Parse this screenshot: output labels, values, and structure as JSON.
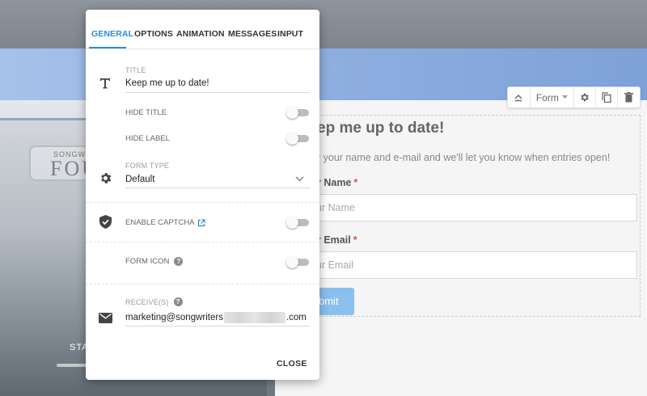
{
  "background": {
    "logo_small": "SONGWRI",
    "logo_big": "FOU",
    "footer_text": "STA"
  },
  "form_preview": {
    "title": "ep me up to date!",
    "description": "r your name and e-mail and we'll let you know when entries open!",
    "name_label": "r Name",
    "name_placeholder": "ur Name",
    "email_label": "r Email",
    "email_placeholder": "ur Email",
    "required_mark": "*",
    "submit_label": "bmit"
  },
  "element_toolbar": {
    "form_label": "Form"
  },
  "modal": {
    "tabs": [
      {
        "label": "GENERAL",
        "active": true
      },
      {
        "label": "OPTIONS",
        "active": false
      },
      {
        "label": "ANIMATION",
        "active": false
      },
      {
        "label": "MESSAGES",
        "active": false
      },
      {
        "label": "INPUT",
        "active": false
      }
    ],
    "title_label": "TITLE",
    "title_value": "Keep me up to date!",
    "hide_title_label": "HIDE TITLE",
    "hide_title_on": false,
    "hide_label_label": "HIDE LABEL",
    "hide_label_on": false,
    "form_type_label": "FORM TYPE",
    "form_type_value": "Default",
    "captcha_label": "ENABLE CAPTCHA",
    "captcha_on": false,
    "form_icon_label": "FORM ICON",
    "form_icon_on": false,
    "receive_label": "RECEIVE(S)",
    "receive_value_prefix": "marketing@songwriters",
    "receive_value_suffix": ".com",
    "help_glyph": "?",
    "close_label": "CLOSE",
    "accent_color": "#2c8bd7"
  }
}
